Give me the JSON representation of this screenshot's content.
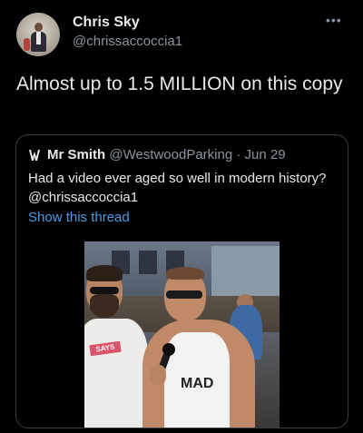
{
  "tweet": {
    "author_name": "Chris Sky",
    "author_handle": "@chrissaccoccia1",
    "more_icon": "•••",
    "text": "Almost up to 1.5 MILLION on this copy"
  },
  "quoted_tweet": {
    "author_name": "Mr Smith",
    "author_handle": "@WestwoodParking",
    "separator": "·",
    "date": "Jun 29",
    "text": "Had a video ever aged so well in modern history? @chrissaccoccia1",
    "show_thread_label": "Show this thread",
    "media": {
      "says_label": "SAYS",
      "shirt_text": "MAD"
    }
  },
  "colors": {
    "background": "#000000",
    "text": "#e7e9ea",
    "muted": "#8b949e",
    "link": "#4a9be8",
    "border": "#3a3f44"
  }
}
